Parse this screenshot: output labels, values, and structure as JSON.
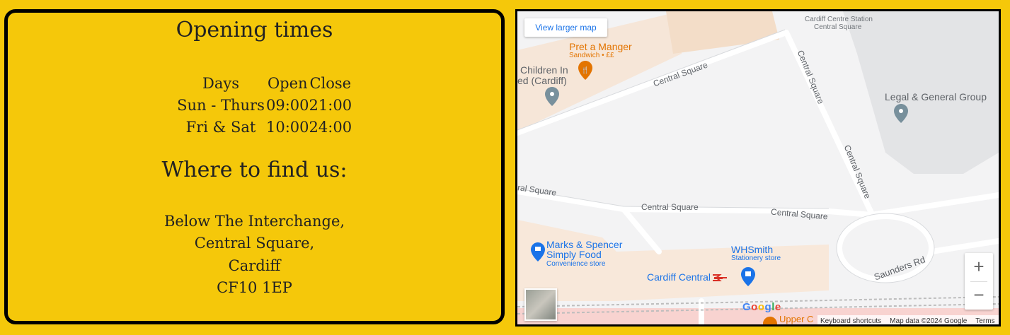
{
  "opening": {
    "title": "Opening times",
    "headers": [
      "Days",
      "Open",
      "Close"
    ],
    "rows": [
      [
        "Sun - Thurs",
        "09:00",
        "21:00"
      ],
      [
        "Fri & Sat",
        "10:00",
        "24:00"
      ]
    ]
  },
  "location": {
    "title": "Where to find us:",
    "address": [
      "Below The Interchange,",
      "Central Square,",
      "Cardiff",
      "CF10 1EP"
    ]
  },
  "map": {
    "larger_map": "View larger map",
    "zoom_in": "+",
    "zoom_out": "−",
    "footer": {
      "shortcuts": "Keyboard shortcuts",
      "data": "Map data ©2024 Google",
      "terms": "Terms"
    },
    "logo": "Google",
    "labels": {
      "station_top_1": "Cardiff Centre Station",
      "station_top_2": "Central Square",
      "pret": "Pret a Manger",
      "pret_sub": "Sandwich • ££",
      "children_1": "Children In",
      "children_2": "ed (Cardiff)",
      "legal": "Legal & General Group",
      "road_central_1": "Central Square",
      "road_central_2": "Central Square",
      "road_central_3": "Central Square",
      "road_central_4": "Central Square",
      "road_central_5": "Central Square",
      "road_central_6": "ral Square",
      "marks_1": "Marks & Spencer",
      "marks_2": "Simply Food",
      "marks_sub": "Convenience store",
      "whsmith": "WHSmith",
      "whsmith_sub": "Stationery store",
      "cardiff_central": "Cardiff Central",
      "saunders": "Saunders Rd",
      "upper": "Upper C"
    },
    "colors": {
      "food_orange": "#e37400",
      "poi_blue": "#1a73e8",
      "pin_grey": "#78909c",
      "station_red": "#d93025"
    }
  }
}
